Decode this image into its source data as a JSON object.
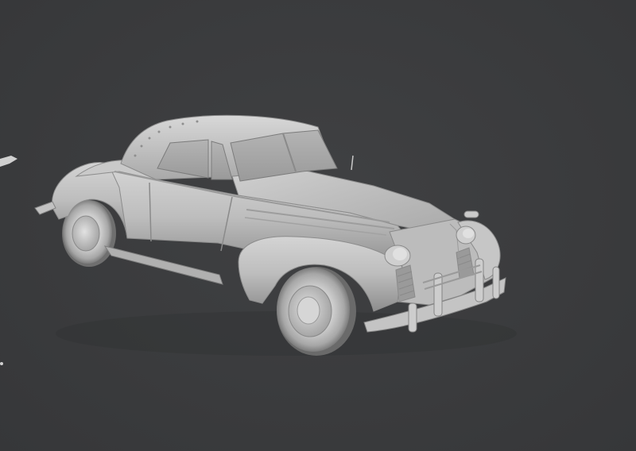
{
  "scene": {
    "background_color": "#3b3c3e",
    "model_color": "#bfbfbf",
    "subject": "car-model",
    "shading": "clay"
  }
}
